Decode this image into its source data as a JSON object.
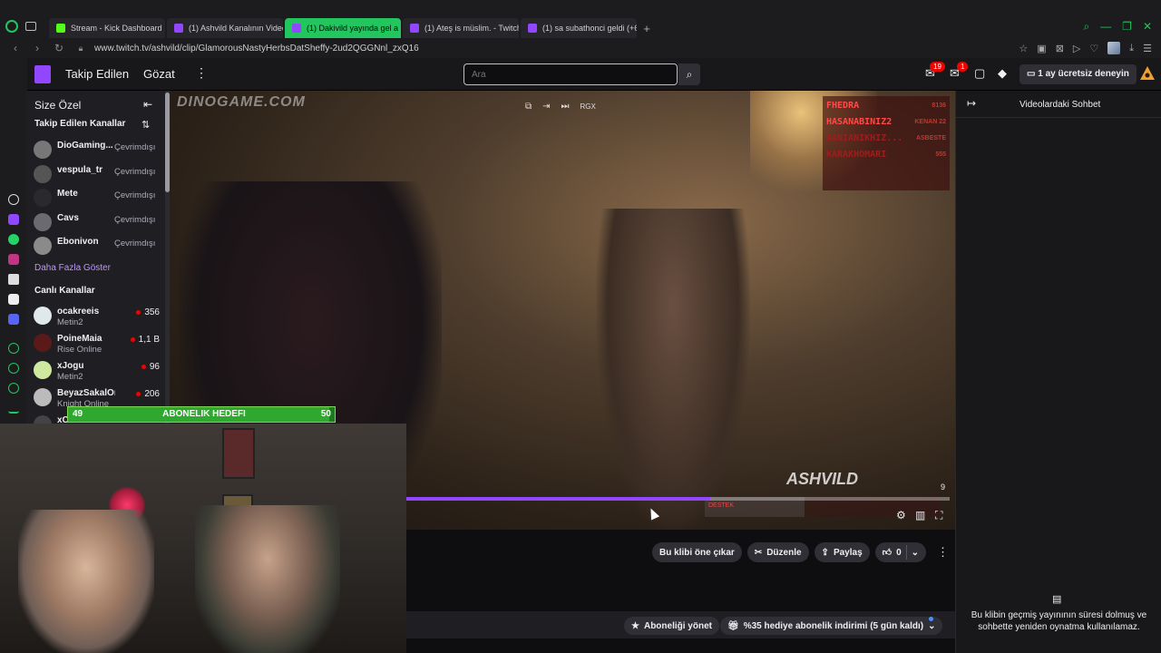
{
  "browser": {
    "tabs": [
      {
        "label": "Stream - Kick Dashboard",
        "icon": "kick"
      },
      {
        "label": "(1) Ashvild Kanalının Video",
        "icon": "twitch"
      },
      {
        "label": "(1) Dakivild yayında gel a",
        "icon": "twitch",
        "active": true
      },
      {
        "label": "(1) Ateş is müslim. - Twitch",
        "icon": "twitch"
      },
      {
        "label": "(1) sa subathonci geldi (+6",
        "icon": "twitch"
      }
    ],
    "new_tab": "+",
    "url": "www.twitch.tv/ashvild/clip/GlamorousNastyHerbsDatSheffy-2ud2QGGNnl_zxQ16"
  },
  "topnav": {
    "following": "Takip Edilen",
    "browse": "Gözat",
    "search_placeholder": "Ara",
    "notifications_count": "19",
    "whispers_count": "1",
    "trial_label": "1 ay ücretsiz deneyin"
  },
  "sidebar": {
    "title": "Size Özel",
    "followed_title": "Takip Edilen Kanallar",
    "followed": [
      {
        "name": "DioGaming...",
        "status": "Çevrimdışı"
      },
      {
        "name": "vespula_tr",
        "status": "Çevrimdışı"
      },
      {
        "name": "Mete",
        "status": "Çevrimdışı"
      },
      {
        "name": "Cavs",
        "status": "Çevrimdışı"
      },
      {
        "name": "Ebonivon",
        "status": "Çevrimdışı"
      }
    ],
    "show_more": "Daha Fazla Göster",
    "live_title": "Canlı Kanallar",
    "live": [
      {
        "name": "ocakreeis",
        "game": "Metin2",
        "viewers": "356"
      },
      {
        "name": "PoineMaia",
        "game": "Rise Online",
        "viewers": "1,1 B"
      },
      {
        "name": "xJogu",
        "game": "Metin2",
        "viewers": "96"
      },
      {
        "name": "BeyazSakalOnli...",
        "game": "Knight Online",
        "viewers": "206"
      },
      {
        "name": "xC",
        "game": "",
        "viewers": ""
      }
    ]
  },
  "video": {
    "watermark": "DINOGAME.COM",
    "overlay_watermark": "ASHVILD",
    "tool_label": "RGX",
    "leaderboard": [
      {
        "name": "FHEDRA",
        "value": "8136"
      },
      {
        "name": "HASANABINIZ2",
        "value": "KENAN 22"
      },
      {
        "name": "RANIANIKHIZ...",
        "value": "ASBESTE"
      },
      {
        "name": "KARAKHOMARI",
        "value": "555"
      },
      {
        "name": "",
        "value": ""
      },
      {
        "name": "",
        "value": ""
      }
    ],
    "time_label": "9",
    "destek_label": "DESTEK",
    "progress": 0.56
  },
  "subgoal": {
    "current": "49",
    "label": "ABONELIK HEDEFI",
    "target": "50",
    "progress": 0.98
  },
  "actions": {
    "feature_clip": "Bu klibi öne çıkar",
    "edit": "Düzenle",
    "share": "Paylaş",
    "likes": "0"
  },
  "bottombar": {
    "manage_sub": "Aboneliği yönet",
    "gift_offer": "%35 hediye abonelik indirimi (5 gün kaldı)"
  },
  "chat": {
    "title": "Videolardaki Sohbet",
    "message": "Bu klibin geçmiş yayınının süresi dolmuş ve sohbette yeniden oynatma kullanılamaz."
  },
  "colors": {
    "twitch_purple": "#9147ff",
    "live_red": "#eb0400",
    "goal_green": "#2ea82e",
    "active_tab": "#22c55e"
  }
}
